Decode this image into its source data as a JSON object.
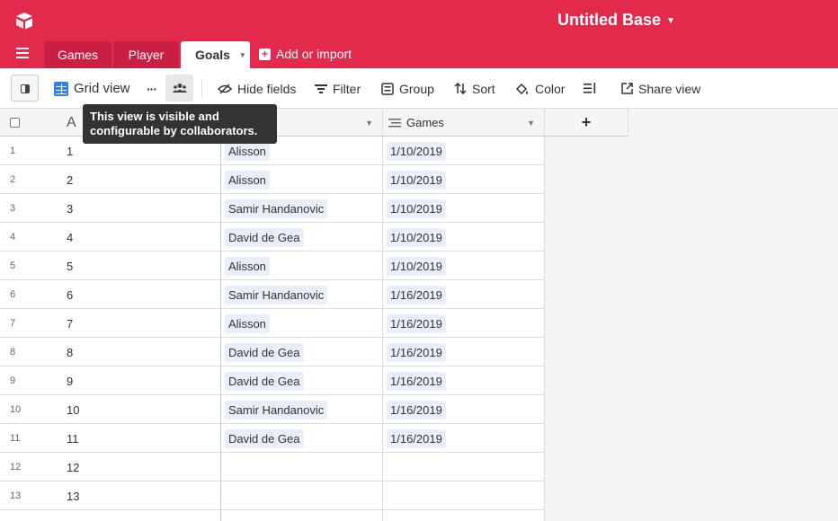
{
  "header": {
    "base_title": "Untitled Base",
    "brand_color": "#e22a4d"
  },
  "tabs": [
    {
      "label": "Games",
      "active": false
    },
    {
      "label": "Player",
      "active": false
    },
    {
      "label": "Goals",
      "active": true
    }
  ],
  "add_import_label": "Add or import",
  "toolbar": {
    "view_name": "Grid view",
    "more_label": "···",
    "hide_fields": "Hide fields",
    "filter": "Filter",
    "group": "Group",
    "sort": "Sort",
    "color": "Color",
    "share_view": "Share view"
  },
  "tooltip": {
    "text_line1": "This view is visible and",
    "text_line2": "configurable by collaborators."
  },
  "columns": {
    "primary": "A",
    "games": "Games",
    "add": "+"
  },
  "rows": [
    {
      "num": "1",
      "a": "1",
      "player": "Alisson",
      "games": "1/10/2019"
    },
    {
      "num": "2",
      "a": "2",
      "player": "Alisson",
      "games": "1/10/2019"
    },
    {
      "num": "3",
      "a": "3",
      "player": "Samir Handanovic",
      "games": "1/10/2019"
    },
    {
      "num": "4",
      "a": "4",
      "player": "David de Gea",
      "games": "1/10/2019"
    },
    {
      "num": "5",
      "a": "5",
      "player": "Alisson",
      "games": "1/10/2019"
    },
    {
      "num": "6",
      "a": "6",
      "player": "Samir Handanovic",
      "games": "1/16/2019"
    },
    {
      "num": "7",
      "a": "7",
      "player": "Alisson",
      "games": "1/16/2019"
    },
    {
      "num": "8",
      "a": "8",
      "player": "David de Gea",
      "games": "1/16/2019"
    },
    {
      "num": "9",
      "a": "9",
      "player": "David de Gea",
      "games": "1/16/2019"
    },
    {
      "num": "10",
      "a": "10",
      "player": "Samir Handanovic",
      "games": "1/16/2019"
    },
    {
      "num": "11",
      "a": "11",
      "player": "David de Gea",
      "games": "1/16/2019"
    },
    {
      "num": "12",
      "a": "12",
      "player": "",
      "games": ""
    },
    {
      "num": "13",
      "a": "13",
      "player": "",
      "games": ""
    },
    {
      "num": "",
      "a": "",
      "player": "",
      "games": ""
    }
  ]
}
